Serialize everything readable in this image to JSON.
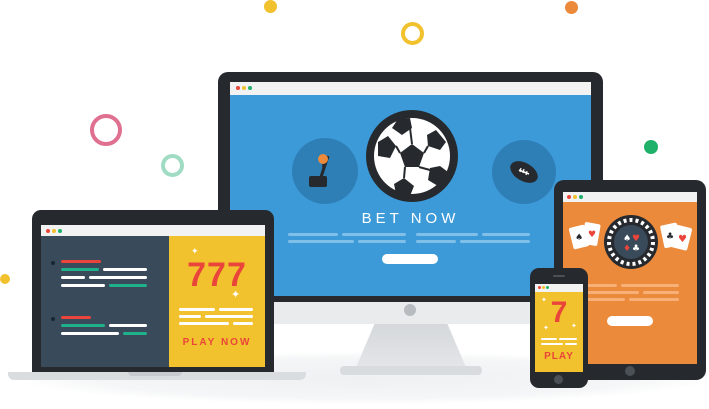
{
  "monitor": {
    "headline": "BET NOW",
    "icons": [
      "golf-icon",
      "soccer-ball-icon",
      "football-icon"
    ]
  },
  "laptop": {
    "slot_number": "777",
    "cta": "PLAY NOW"
  },
  "phone": {
    "slot_number": "7",
    "cta": "PLAY"
  },
  "tablet": {
    "icons": [
      "playing-cards-icon",
      "roulette-wheel-icon",
      "playing-cards-icon"
    ]
  },
  "colors": {
    "monitor_screen": "#3d9ad8",
    "laptop_code_panel": "#394a5a",
    "slot_yellow": "#f2c12e",
    "slot_red": "#e9453a",
    "tablet_orange": "#ec8a3c",
    "device_frame": "#262a2e"
  }
}
